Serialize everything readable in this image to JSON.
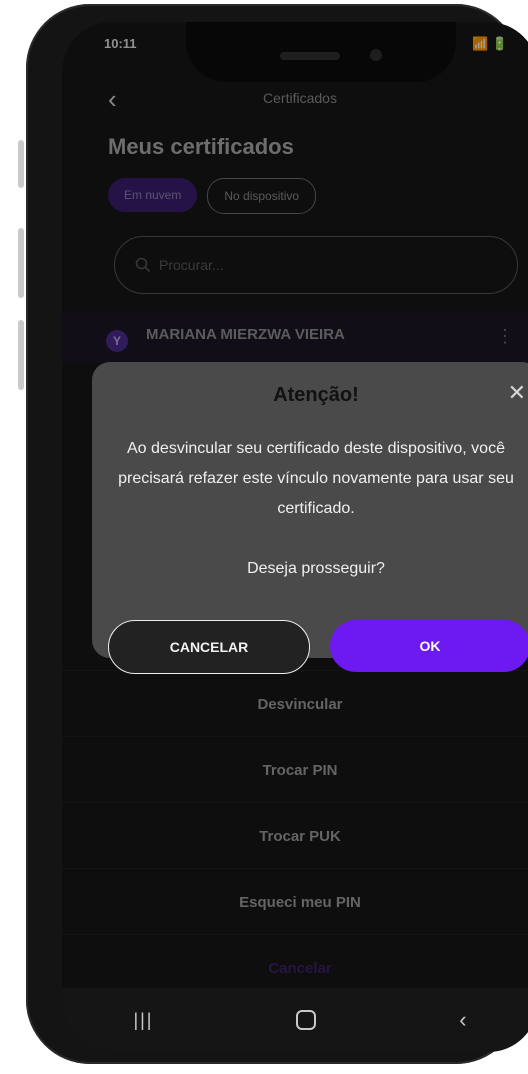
{
  "status_bar": {
    "time": "10:11",
    "right": "📶 🔋"
  },
  "header": {
    "title": "Certificados"
  },
  "page_title": "Meus certificados",
  "chips": [
    {
      "label": "Em nuvem"
    },
    {
      "label": "No dispositivo"
    }
  ],
  "search": {
    "placeholder": "Procurar..."
  },
  "certificate": {
    "initial": "Y",
    "name": "MARIANA MIERZWA VIEIRA"
  },
  "sheet": {
    "items": [
      {
        "label": "Desvincular"
      },
      {
        "label": "Trocar PIN"
      },
      {
        "label": "Trocar PUK"
      },
      {
        "label": "Esqueci meu PIN"
      }
    ],
    "cancel": "Cancelar"
  },
  "dialog": {
    "title": "Atenção!",
    "message": "Ao desvincular seu certificado deste dispositivo, você precisará refazer este vínculo novamente para usar seu certificado.",
    "question": "Deseja prosseguir?",
    "cancel_label": "CANCELAR",
    "ok_label": "OK",
    "colors": {
      "ok": "#6d19f2"
    }
  }
}
